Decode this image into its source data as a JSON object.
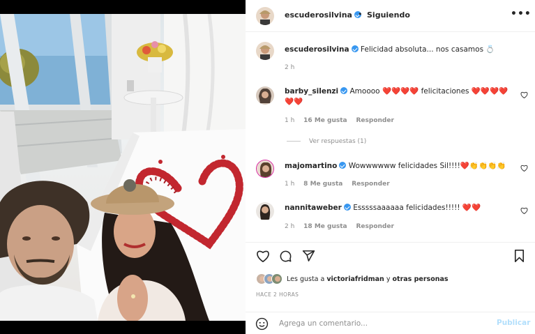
{
  "post": {
    "username": "escuderosilvina",
    "separator": "•",
    "follow_status": "Siguiendo",
    "more_icon": "more-options-icon"
  },
  "caption": {
    "username": "escuderosilvina",
    "text": "Felicidad absoluta... nos casamos 💍",
    "time": "2 h"
  },
  "comments": [
    {
      "username": "barby_silenzi",
      "text": "Amoooo ❤️❤️❤️❤️ felicitaciones ❤️❤️❤️❤️❤️❤️",
      "time": "1 h",
      "likes": "16 Me gusta",
      "reply": "Responder",
      "view_replies": "Ver respuestas (1)"
    },
    {
      "username": "majomartino",
      "text": "Wowwwwww felicidades Sil!!!!❤️👏👏👏👏",
      "time": "1 h",
      "likes": "8 Me gusta",
      "reply": "Responder"
    },
    {
      "username": "nannitaweber",
      "text": "Esssssaaaaaa felicidades!!!!! ❤️❤️",
      "time": "2 h",
      "likes": "18 Me gusta",
      "reply": "Responder"
    }
  ],
  "likes_line": {
    "prefix": "Les gusta a",
    "user": "victoriafridman",
    "middle": "y",
    "rest": "otras personas"
  },
  "time_ago": "HACE 2 HORAS",
  "add_comment": {
    "placeholder": "Agrega un comentario...",
    "publish_label": "Publicar"
  },
  "colors": {
    "accent_blue": "#3897f0",
    "publish_disabled": "#b2dffc",
    "heart_red": "#e0245e",
    "muted_text": "#8e8e8e"
  }
}
